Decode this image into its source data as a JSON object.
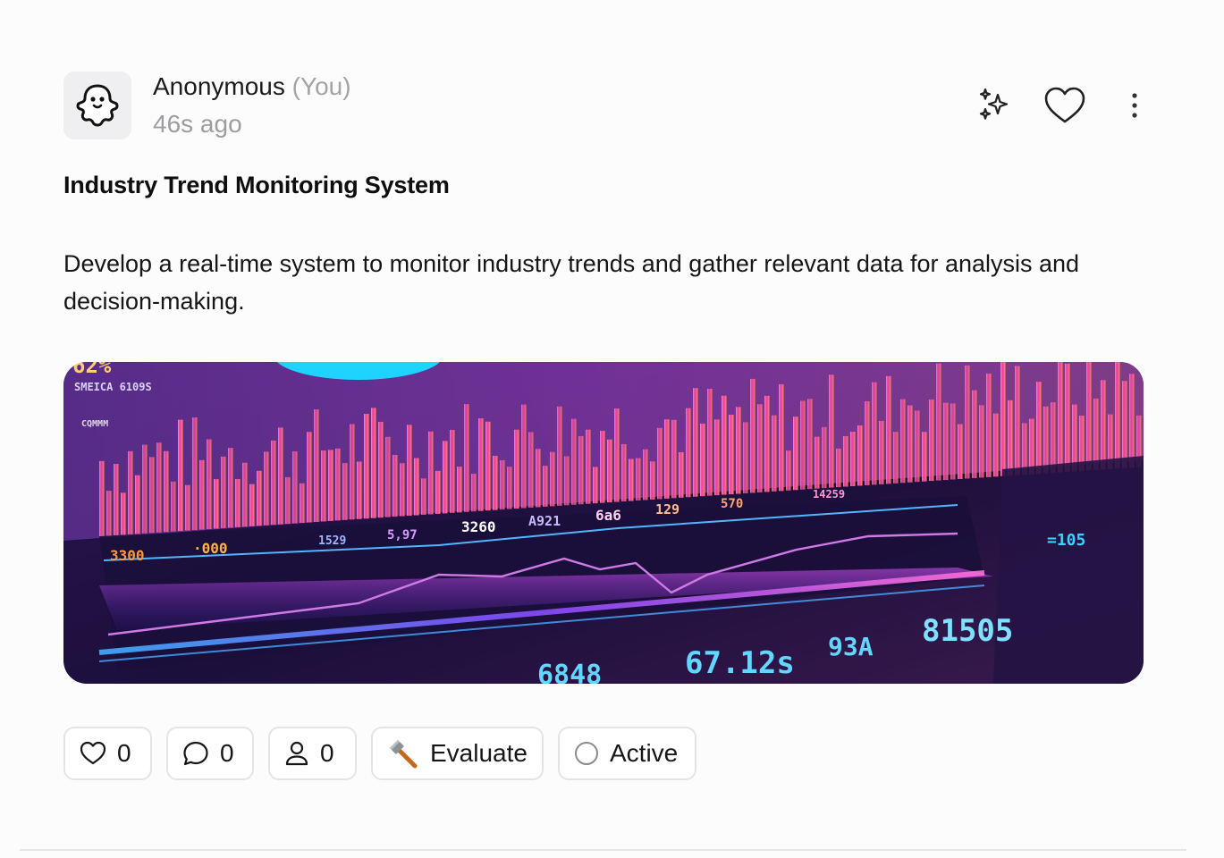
{
  "post": {
    "author": "Anonymous",
    "author_suffix": "(You)",
    "time_ago": "46s ago",
    "title": "Industry Trend Monitoring System",
    "description": "Develop a real-time system to monitor industry trends and gather relevant data for analysis and decision-making."
  },
  "header_icons": [
    "ghost-avatar-icon",
    "sparkles-icon",
    "heart-icon",
    "more-vertical-icon"
  ],
  "footer": {
    "likes_count": "0",
    "comments_count": "0",
    "members_count": "0",
    "evaluate_label": "Evaluate",
    "status_label": "Active"
  },
  "hero_image": {
    "overlay_texts": [
      "62%",
      "SMEICA 6109S",
      "CQMMM",
      "3300",
      "·000",
      "1529",
      "5,97",
      "3260",
      "A921",
      "6a6",
      "129",
      "570",
      "14259",
      "6848",
      "67.12s",
      "93A",
      "81505",
      "=105"
    ]
  },
  "colors": {
    "accent_orange": "#ff8a1f",
    "accent_magenta": "#e83cc7",
    "accent_cyan": "#1fd3ff",
    "hero_bg": "#1a1036",
    "border": "#e4e4e7",
    "muted_text": "#9c9ca1"
  }
}
